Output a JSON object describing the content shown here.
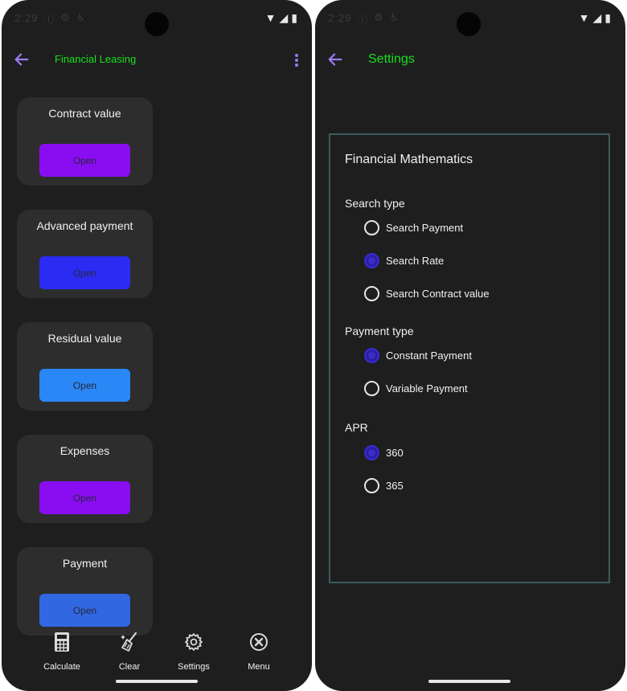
{
  "status_bar": {
    "time": "2:29"
  },
  "left_screen": {
    "title": "Financial Leasing",
    "cards": [
      {
        "title": "Contract value",
        "button_label": "Open",
        "button_color": "#8a0df2"
      },
      {
        "title": "Advanced payment",
        "button_label": "Open",
        "button_color": "#2b2bf4"
      },
      {
        "title": "Residual value",
        "button_label": "Open",
        "button_color": "#2a87f6"
      },
      {
        "title": "Expenses",
        "button_label": "Open",
        "button_color": "#8a0df2"
      },
      {
        "title": "Payment",
        "button_label": "Open",
        "button_color": "#3168e2"
      }
    ],
    "bottom_nav": [
      {
        "label": "Calculate",
        "icon": "calculator-icon"
      },
      {
        "label": "Clear",
        "icon": "broom-icon"
      },
      {
        "label": "Settings",
        "icon": "gear-icon"
      },
      {
        "label": "Menu",
        "icon": "close-circle-icon"
      }
    ]
  },
  "right_screen": {
    "title": "Settings",
    "panel_title": "Financial Mathematics",
    "search_type": {
      "label": "Search type",
      "options": [
        {
          "label": "Search Payment",
          "selected": false
        },
        {
          "label": "Search Rate",
          "selected": true
        },
        {
          "label": "Search Contract value",
          "selected": false
        }
      ]
    },
    "payment_type": {
      "label": "Payment type",
      "options": [
        {
          "label": "Constant Payment",
          "selected": true
        },
        {
          "label": "Variable Payment",
          "selected": false
        }
      ]
    },
    "apr": {
      "label": "APR",
      "options": [
        {
          "label": "360",
          "selected": true
        },
        {
          "label": "365",
          "selected": false
        }
      ]
    }
  },
  "colors": {
    "title_green": "#19e019",
    "accent_purple": "#9b7bf0",
    "background": "#1e1e1f",
    "card": "#2d2d2e",
    "panel_border": "#3c5c5c"
  }
}
